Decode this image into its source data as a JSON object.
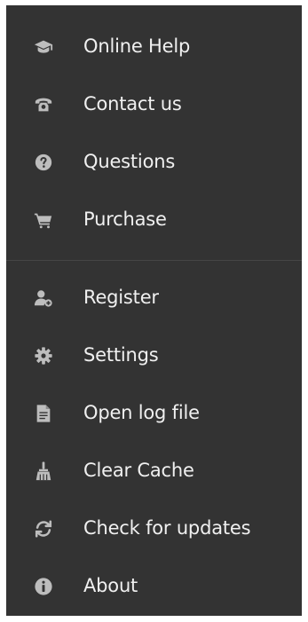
{
  "menu": {
    "groups": [
      {
        "items": [
          {
            "label": "Online Help",
            "icon": "graduation-cap-icon"
          },
          {
            "label": "Contact us",
            "icon": "telephone-icon"
          },
          {
            "label": "Questions",
            "icon": "question-circle-icon"
          },
          {
            "label": "Purchase",
            "icon": "shopping-cart-icon"
          }
        ]
      },
      {
        "items": [
          {
            "label": "Register",
            "icon": "user-add-icon"
          },
          {
            "label": "Settings",
            "icon": "gear-icon"
          },
          {
            "label": "Open log file",
            "icon": "document-icon"
          },
          {
            "label": "Clear Cache",
            "icon": "broom-icon"
          },
          {
            "label": "Check for updates",
            "icon": "refresh-icon"
          },
          {
            "label": "About",
            "icon": "info-circle-icon"
          }
        ]
      }
    ],
    "colors": {
      "background": "#333333",
      "text": "#f0f0f0",
      "icon": "#bdbdbd",
      "divider": "#454545"
    }
  }
}
